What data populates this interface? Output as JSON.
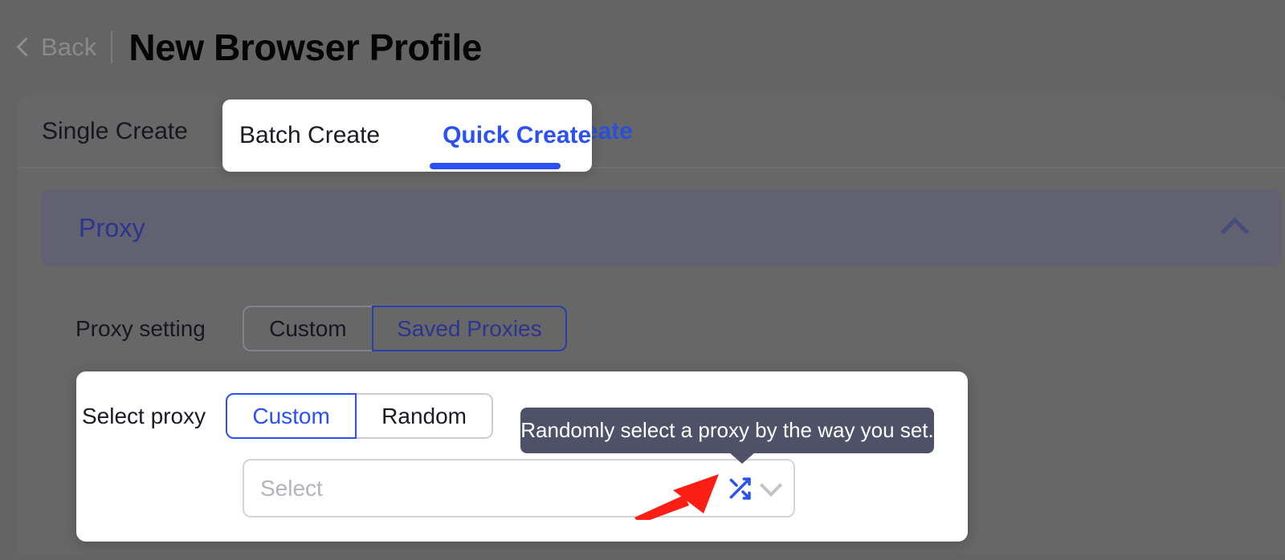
{
  "header": {
    "back_label": "Back",
    "back_icon": "chevron-left-icon",
    "title": "New Browser Profile"
  },
  "tabs": [
    {
      "label": "Single Create",
      "active": false
    },
    {
      "label": "Batch Create",
      "active": false
    },
    {
      "label": "Quick Create",
      "active": true
    }
  ],
  "section": {
    "title": "Proxy",
    "collapse_icon": "chevron-up-icon",
    "collapsed": false
  },
  "proxy_setting": {
    "label": "Proxy setting",
    "options": [
      "Custom",
      "Saved Proxies"
    ],
    "selected": "Saved Proxies"
  },
  "select_proxy": {
    "label": "Select proxy",
    "options": [
      "Custom",
      "Random"
    ],
    "selected": "Custom",
    "dropdown": {
      "placeholder": "Select",
      "value": "",
      "shuffle_icon": "shuffle-icon",
      "expand_icon": "chevron-down-icon"
    }
  },
  "tooltip": {
    "text": "Randomly select a proxy by the way you set."
  },
  "annotation": {
    "type": "red-arrow",
    "points_at": "shuffle-icon",
    "color": "#fa1e14"
  },
  "colors": {
    "overlay_gray": "#646464",
    "panel_gray": "#676768",
    "section_gray": "#616171",
    "accent_blue": "#2b50f6",
    "dim_blue": "#2b3590",
    "tooltip_bg": "#4e5168",
    "card_white": "#ffffff"
  }
}
